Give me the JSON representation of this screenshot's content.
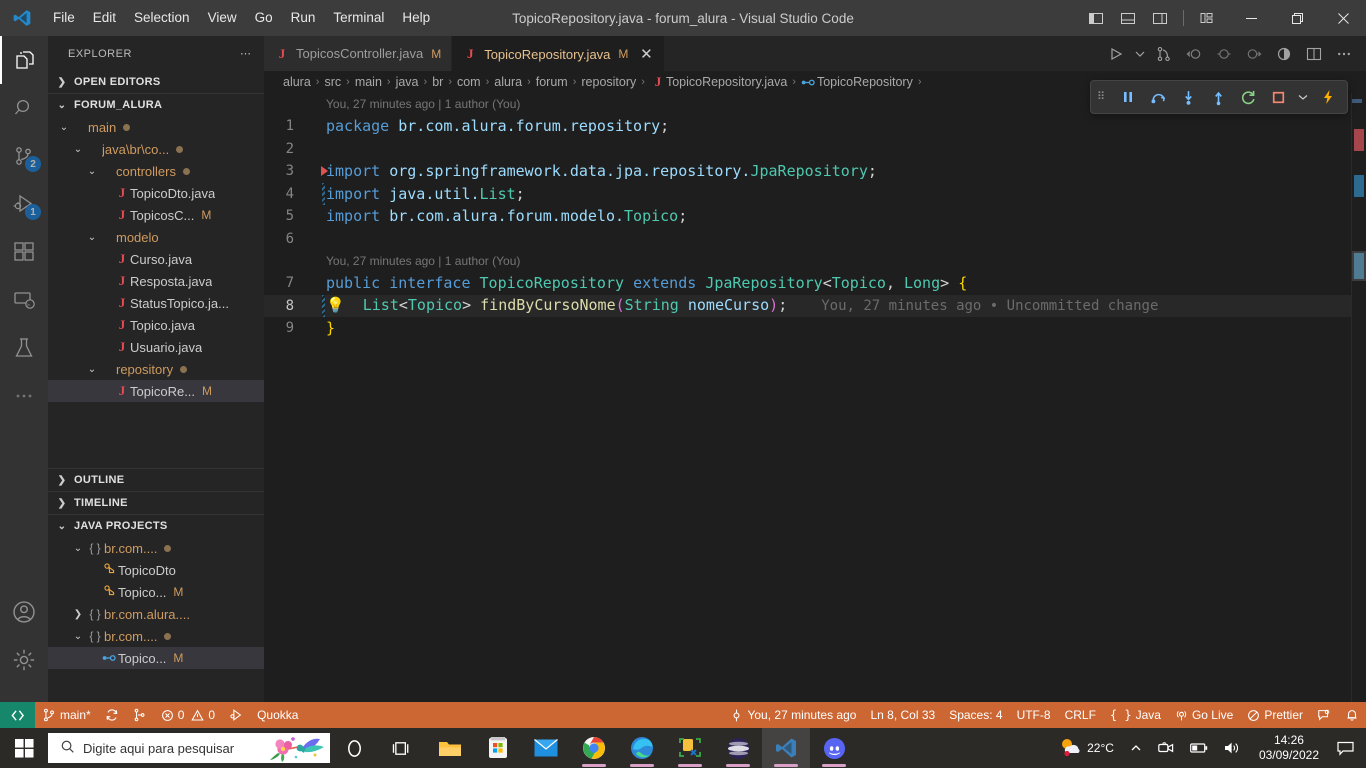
{
  "titlebar": {
    "logo_icon": "vscode-logo",
    "menus": [
      "File",
      "Edit",
      "Selection",
      "View",
      "Go",
      "Run",
      "Terminal",
      "Help"
    ],
    "window_title": "TopicoRepository.java - forum_alura - Visual Studio Code",
    "layout_buttons": [
      {
        "name": "toggle-primary-sidebar",
        "icon": "panel-left-icon"
      },
      {
        "name": "toggle-panel",
        "icon": "panel-bottom-icon"
      },
      {
        "name": "toggle-secondary-sidebar",
        "icon": "panel-right-icon"
      },
      {
        "name": "customize-layout",
        "icon": "layout-grid-icon"
      }
    ],
    "window_controls": {
      "minimize": "─",
      "maximize": "❐",
      "close": "✕"
    }
  },
  "activitybar": {
    "items": [
      {
        "name": "explorer",
        "icon": "files-icon",
        "badge": "",
        "active": true
      },
      {
        "name": "search",
        "icon": "search-icon",
        "badge": "",
        "active": false
      },
      {
        "name": "source-control",
        "icon": "source-control-icon",
        "badge": "2",
        "active": false
      },
      {
        "name": "run-and-debug",
        "icon": "debug-icon",
        "badge": "1",
        "active": false
      },
      {
        "name": "extensions",
        "icon": "extensions-icon",
        "badge": "",
        "active": false
      },
      {
        "name": "remote-explorer",
        "icon": "remote-icon",
        "badge": "",
        "active": false
      },
      {
        "name": "testing",
        "icon": "beaker-icon",
        "badge": "",
        "active": false
      },
      {
        "name": "additional-views",
        "icon": "ellipsis-icon",
        "badge": "",
        "active": false
      }
    ],
    "bottom": [
      {
        "name": "accounts",
        "icon": "account-icon"
      },
      {
        "name": "manage-settings",
        "icon": "gear-icon"
      }
    ]
  },
  "sidebar": {
    "title": "EXPLORER",
    "more_actions_icon": "ellipsis-icon",
    "sections": [
      {
        "label": "OPEN EDITORS",
        "expanded": false
      },
      {
        "label": "FORUM_ALURA",
        "expanded": true
      },
      {
        "label": "OUTLINE",
        "expanded": false
      },
      {
        "label": "TIMELINE",
        "expanded": false
      },
      {
        "label": "JAVA PROJECTS",
        "expanded": true
      }
    ],
    "tree": [
      {
        "label": "main",
        "type": "folder",
        "indent": 1,
        "expanded": true,
        "dot": true,
        "flag": ""
      },
      {
        "label": "java\\br\\co...",
        "type": "folder",
        "indent": 2,
        "expanded": true,
        "dot": true,
        "flag": ""
      },
      {
        "label": "controllers",
        "type": "folder",
        "indent": 3,
        "expanded": true,
        "dot": true,
        "flag": ""
      },
      {
        "label": "TopicoDto.java",
        "type": "java",
        "indent": 4,
        "expanded": null,
        "dot": false,
        "flag": ""
      },
      {
        "label": "TopicosC...",
        "type": "java",
        "indent": 4,
        "expanded": null,
        "dot": false,
        "flag": "M"
      },
      {
        "label": "modelo",
        "type": "folder",
        "indent": 3,
        "expanded": true,
        "dot": false,
        "flag": ""
      },
      {
        "label": "Curso.java",
        "type": "java",
        "indent": 4,
        "expanded": null,
        "dot": false,
        "flag": ""
      },
      {
        "label": "Resposta.java",
        "type": "java",
        "indent": 4,
        "expanded": null,
        "dot": false,
        "flag": ""
      },
      {
        "label": "StatusTopico.ja...",
        "type": "java",
        "indent": 4,
        "expanded": null,
        "dot": false,
        "flag": ""
      },
      {
        "label": "Topico.java",
        "type": "java",
        "indent": 4,
        "expanded": null,
        "dot": false,
        "flag": ""
      },
      {
        "label": "Usuario.java",
        "type": "java",
        "indent": 4,
        "expanded": null,
        "dot": false,
        "flag": ""
      },
      {
        "label": "repository",
        "type": "folder",
        "indent": 3,
        "expanded": true,
        "dot": true,
        "flag": ""
      },
      {
        "label": "TopicoRe...",
        "type": "java",
        "indent": 4,
        "expanded": null,
        "dot": false,
        "flag": "M",
        "selected": true
      }
    ],
    "java_projects": [
      {
        "label": "br.com....",
        "type": "package",
        "indent": 2,
        "expanded": true,
        "dot": true,
        "flag": ""
      },
      {
        "label": "TopicoDto",
        "type": "class",
        "indent": 3,
        "expanded": null,
        "dot": false,
        "flag": ""
      },
      {
        "label": "Topico...",
        "type": "class",
        "indent": 3,
        "expanded": null,
        "dot": false,
        "flag": "M"
      },
      {
        "label": "br.com.alura....",
        "type": "package",
        "indent": 2,
        "expanded": false,
        "dot": false,
        "flag": ""
      },
      {
        "label": "br.com....",
        "type": "package",
        "indent": 2,
        "expanded": true,
        "dot": true,
        "flag": ""
      },
      {
        "label": "Topico...",
        "type": "interface",
        "indent": 3,
        "expanded": null,
        "dot": false,
        "flag": "M",
        "selected": true
      }
    ]
  },
  "editor": {
    "tabs": [
      {
        "label": "TopicosController.java",
        "flag": "M",
        "active": false,
        "icon": "java-file-icon"
      },
      {
        "label": "TopicoRepository.java",
        "flag": "M",
        "active": true,
        "icon": "java-file-icon",
        "close_icon": "close-icon"
      }
    ],
    "tab_actions": [
      {
        "name": "run-or-debug",
        "icon": "play-icon"
      },
      {
        "name": "run-dropdown",
        "icon": "chevron-down-icon"
      },
      {
        "name": "source-control-graph",
        "icon": "git-graph-icon"
      },
      {
        "name": "go-to-previous-change",
        "icon": "arrow-left-circle-icon"
      },
      {
        "name": "stage-change",
        "icon": "circle-icon"
      },
      {
        "name": "go-to-next-change",
        "icon": "circle-arrow-right-icon"
      },
      {
        "name": "toggle-inline-diff",
        "icon": "half-circle-icon"
      },
      {
        "name": "split-editor-right",
        "icon": "split-editor-icon"
      },
      {
        "name": "more-editor-actions",
        "icon": "ellipsis-icon"
      }
    ],
    "breadcrumbs": [
      "alura",
      "src",
      "main",
      "java",
      "br",
      "com",
      "alura",
      "forum",
      "repository",
      "TopicoRepository.java",
      "TopicoRepository"
    ],
    "breadcrumb_separator": "›",
    "debug_toolbar": [
      {
        "name": "drag-handle",
        "icon": "grip-icon"
      },
      {
        "name": "pause",
        "icon": "pause-icon"
      },
      {
        "name": "step-over",
        "icon": "step-over-icon"
      },
      {
        "name": "step-into",
        "icon": "step-into-icon"
      },
      {
        "name": "step-out",
        "icon": "step-out-icon"
      },
      {
        "name": "restart",
        "icon": "restart-icon"
      },
      {
        "name": "stop",
        "icon": "stop-icon"
      },
      {
        "name": "session-dropdown",
        "icon": "chevron-down-icon"
      },
      {
        "name": "hot-reload",
        "icon": "lightning-icon"
      }
    ],
    "blame_headers": [
      {
        "text": "You, 27 minutes ago | 1 author (You)"
      },
      {
        "text": "You, 27 minutes ago | 1 author (You)"
      }
    ],
    "inline_blame": "You, 27 minutes ago • Uncommitted change",
    "line_numbers": [
      "1",
      "2",
      "3",
      "4",
      "5",
      "6",
      "7",
      "8",
      "9"
    ],
    "code_lines": [
      {
        "n": "1",
        "tokens": [
          {
            "t": "package",
            "c": "kw"
          },
          {
            "t": " ",
            "c": "pln"
          },
          {
            "t": "br.com.alura.forum.repository",
            "c": "id"
          },
          {
            "t": ";",
            "c": "pln"
          }
        ]
      },
      {
        "n": "2",
        "tokens": []
      },
      {
        "n": "3",
        "tokens": [
          {
            "t": "import",
            "c": "kw"
          },
          {
            "t": " ",
            "c": "pln"
          },
          {
            "t": "org.springframework.data.jpa.repository.",
            "c": "id"
          },
          {
            "t": "JpaRepository",
            "c": "typ"
          },
          {
            "t": ";",
            "c": "pln"
          }
        ]
      },
      {
        "n": "4",
        "tokens": [
          {
            "t": "import",
            "c": "kw"
          },
          {
            "t": " ",
            "c": "pln"
          },
          {
            "t": "java.util.",
            "c": "id"
          },
          {
            "t": "List",
            "c": "typ"
          },
          {
            "t": ";",
            "c": "pln"
          }
        ]
      },
      {
        "n": "5",
        "tokens": [
          {
            "t": "import",
            "c": "kw"
          },
          {
            "t": " ",
            "c": "pln"
          },
          {
            "t": "br.com.alura.forum.modelo.",
            "c": "id"
          },
          {
            "t": "Topico",
            "c": "typ"
          },
          {
            "t": ";",
            "c": "pln"
          }
        ]
      },
      {
        "n": "6",
        "tokens": []
      },
      {
        "n": "7",
        "tokens": [
          {
            "t": "public",
            "c": "kw"
          },
          {
            "t": " ",
            "c": "pln"
          },
          {
            "t": "interface",
            "c": "kw"
          },
          {
            "t": " ",
            "c": "pln"
          },
          {
            "t": "TopicoRepository",
            "c": "typ"
          },
          {
            "t": " ",
            "c": "pln"
          },
          {
            "t": "extends",
            "c": "kw"
          },
          {
            "t": " ",
            "c": "pln"
          },
          {
            "t": "JpaRepository",
            "c": "typ"
          },
          {
            "t": "<",
            "c": "pln"
          },
          {
            "t": "Topico",
            "c": "typ"
          },
          {
            "t": ", ",
            "c": "pln"
          },
          {
            "t": "Long",
            "c": "typ"
          },
          {
            "t": "> ",
            "c": "pln"
          },
          {
            "t": "{",
            "c": "brace"
          }
        ]
      },
      {
        "n": "8",
        "tokens": [
          {
            "t": "  ",
            "c": "pln"
          },
          {
            "t": "List",
            "c": "typ"
          },
          {
            "t": "<",
            "c": "pln"
          },
          {
            "t": "Topico",
            "c": "typ"
          },
          {
            "t": "> ",
            "c": "pln"
          },
          {
            "t": "findByCursoNome",
            "c": "fn"
          },
          {
            "t": "(",
            "c": "brace2"
          },
          {
            "t": "String",
            "c": "typ"
          },
          {
            "t": " ",
            "c": "pln"
          },
          {
            "t": "nomeCurso",
            "c": "id"
          },
          {
            "t": ")",
            "c": "brace2"
          },
          {
            "t": ";",
            "c": "pln"
          }
        ]
      },
      {
        "n": "9",
        "tokens": [
          {
            "t": "}",
            "c": "brace"
          }
        ]
      }
    ],
    "code_quick_fix_icon": "lightbulb-icon"
  },
  "statusbar": {
    "remote_icon": "remote-window-icon",
    "left": [
      {
        "name": "branch",
        "icon": "git-branch-icon",
        "label": "main*"
      },
      {
        "name": "sync-changes",
        "icon": "sync-icon",
        "label": ""
      },
      {
        "name": "source-control-graph",
        "icon": "git-graph-icon",
        "label": ""
      },
      {
        "name": "problems",
        "icon": "error-warning-icon",
        "label": "0 ⚠ 0",
        "errors": "0",
        "warnings": "0"
      },
      {
        "name": "debug-start",
        "icon": "debug-alt-icon",
        "label": ""
      },
      {
        "name": "quokka",
        "icon": "",
        "label": "Quokka"
      }
    ],
    "right": [
      {
        "name": "git-blame",
        "icon": "git-commit-icon",
        "label": "You, 27 minutes ago"
      },
      {
        "name": "cursor-position",
        "icon": "",
        "label": "Ln 8, Col 33"
      },
      {
        "name": "indentation",
        "icon": "",
        "label": "Spaces: 4"
      },
      {
        "name": "encoding",
        "icon": "",
        "label": "UTF-8"
      },
      {
        "name": "eol",
        "icon": "",
        "label": "CRLF"
      },
      {
        "name": "language-mode",
        "icon": "brackets-icon",
        "label": "Java"
      },
      {
        "name": "go-live",
        "icon": "broadcast-icon",
        "label": "Go Live"
      },
      {
        "name": "prettier",
        "icon": "prettier-icon",
        "label": "Prettier"
      },
      {
        "name": "feedback",
        "icon": "feedback-icon",
        "label": ""
      },
      {
        "name": "notifications",
        "icon": "bell-icon",
        "label": ""
      }
    ],
    "background_color": "#cc6633"
  },
  "taskbar": {
    "start_icon": "windows-start-icon",
    "search_placeholder": "Digite aqui para pesquisar",
    "search_icon": "search-icon",
    "search_decoration_icon": "hummingbird-flower-icon",
    "pinned": [
      {
        "name": "cortana",
        "icon": "cortana-circle-icon"
      },
      {
        "name": "task-view",
        "icon": "task-view-icon"
      },
      {
        "name": "file-explorer",
        "icon": "folder-icon"
      },
      {
        "name": "microsoft-store",
        "icon": "store-icon"
      },
      {
        "name": "mail",
        "icon": "mail-icon"
      },
      {
        "name": "google-chrome",
        "icon": "chrome-icon"
      },
      {
        "name": "microsoft-edge",
        "icon": "edge-icon"
      },
      {
        "name": "snipping-tool",
        "icon": "snip-tool-icon"
      },
      {
        "name": "eclipse",
        "icon": "eclipse-icon"
      },
      {
        "name": "visual-studio-code",
        "icon": "vscode-icon"
      },
      {
        "name": "discord",
        "icon": "discord-icon"
      }
    ],
    "tray": {
      "weather_temp": "22°C",
      "weather_icon": "sun-cloud-icon",
      "chevron_icon": "chevron-up-icon",
      "items": [
        {
          "name": "camera-tray-icon",
          "icon": "camera-icon"
        },
        {
          "name": "battery-tray-icon",
          "icon": "battery-icon"
        },
        {
          "name": "volume-tray-icon",
          "icon": "speaker-icon"
        }
      ],
      "time": "14:26",
      "date": "03/09/2022",
      "action-center-icon": "notification-icon"
    }
  }
}
